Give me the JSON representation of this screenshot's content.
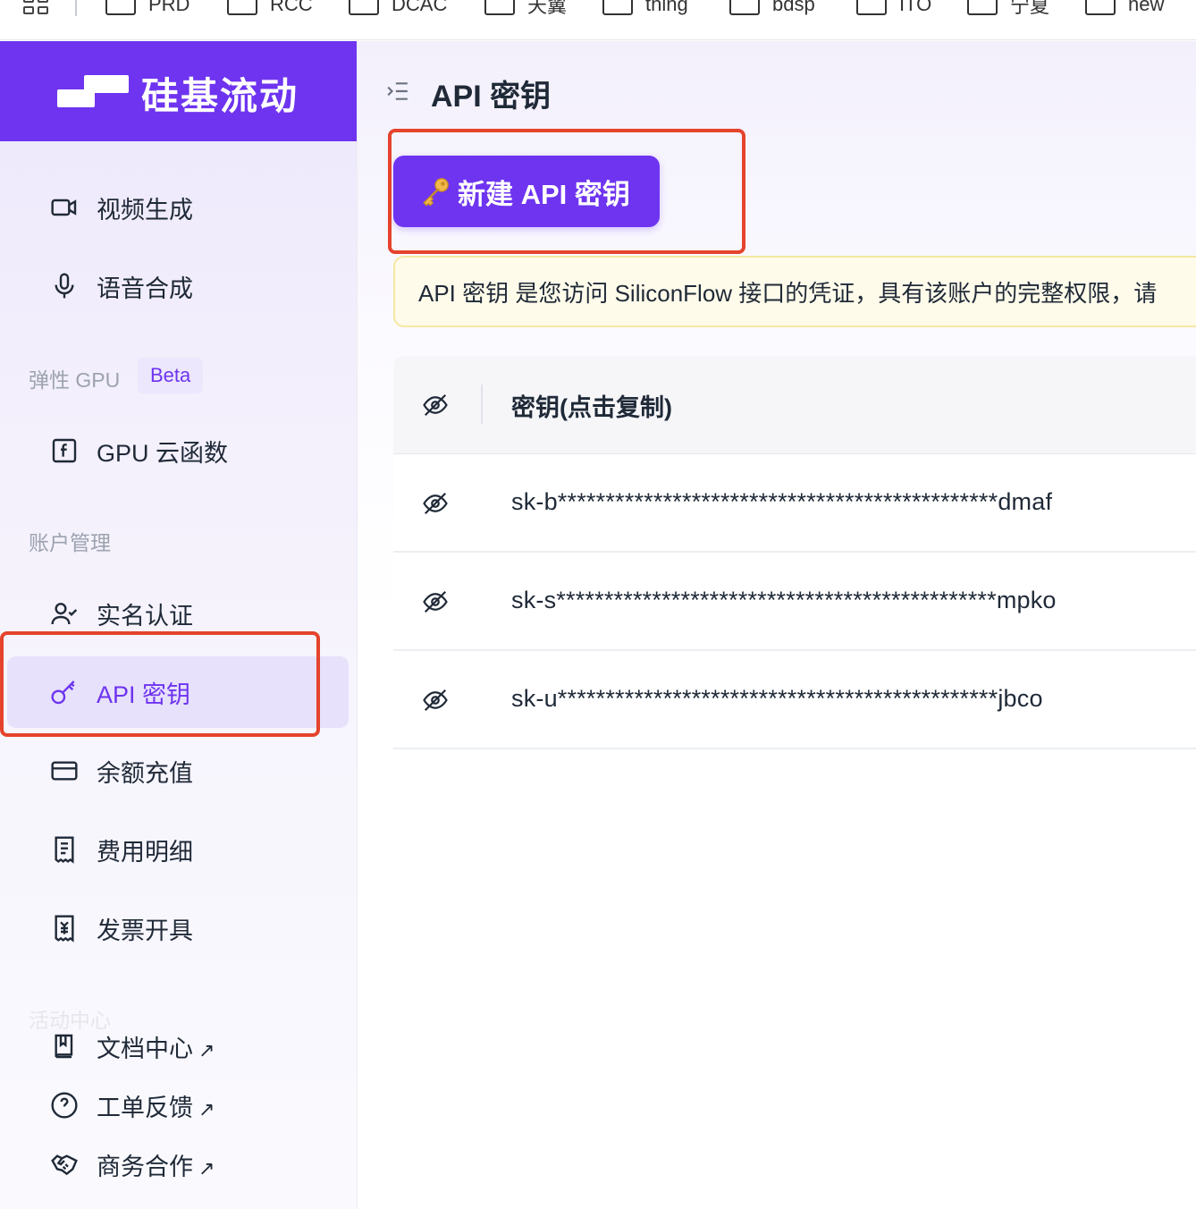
{
  "bookmarks": {
    "items": [
      {
        "label": "PRD"
      },
      {
        "label": "RCC"
      },
      {
        "label": "DCAC"
      },
      {
        "label": "天翼"
      },
      {
        "label": "thing"
      },
      {
        "label": "bdsp"
      },
      {
        "label": "ITO"
      },
      {
        "label": "宁夏"
      },
      {
        "label": "new"
      }
    ]
  },
  "brand": {
    "name": "硅基流动"
  },
  "sidebar": {
    "items_top": [
      {
        "label": "视频生成",
        "icon": "video-camera-icon"
      },
      {
        "label": "语音合成",
        "icon": "microphone-icon"
      }
    ],
    "section_gpu": {
      "label": "弹性 GPU",
      "badge": "Beta"
    },
    "gpu_item": {
      "label": "GPU 云函数",
      "icon": "function-icon"
    },
    "section_account": {
      "label": "账户管理"
    },
    "account_items": [
      {
        "label": "实名认证",
        "icon": "user-check-icon"
      },
      {
        "label": "API 密钥",
        "icon": "key-icon",
        "active": true
      },
      {
        "label": "余额充值",
        "icon": "credit-card-icon"
      },
      {
        "label": "费用明细",
        "icon": "receipt-icon"
      },
      {
        "label": "发票开具",
        "icon": "invoice-icon"
      }
    ],
    "section_activity": {
      "label": "活动中心"
    },
    "bottom_items": [
      {
        "label": "文档中心",
        "icon": "book-icon",
        "external": "↗"
      },
      {
        "label": "工单反馈",
        "icon": "question-circle-icon",
        "external": "↗"
      },
      {
        "label": "商务合作",
        "icon": "handshake-icon",
        "external": "↗"
      }
    ]
  },
  "main": {
    "title": "API 密钥",
    "new_button": "新建 API 密钥",
    "notice": "API 密钥 是您访问 SiliconFlow 接口的凭证，具有该账户的完整权限，请",
    "table": {
      "header": "密钥(点击复制)",
      "rows": [
        {
          "key": "sk-b**********************************************dmaf"
        },
        {
          "key": "sk-s**********************************************mpko"
        },
        {
          "key": "sk-u**********************************************jbco"
        }
      ]
    }
  },
  "colors": {
    "accent": "#6e34f0",
    "highlight": "#e5432c",
    "notice_bg": "#fffbea"
  }
}
